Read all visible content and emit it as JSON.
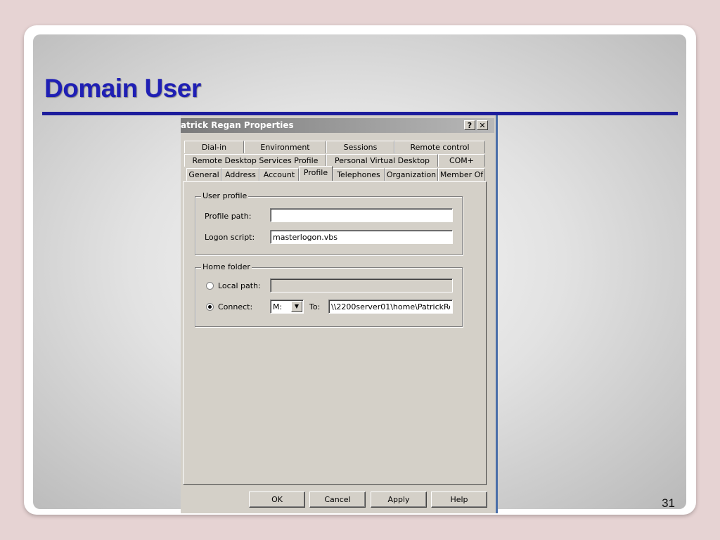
{
  "slide": {
    "title": "Domain User",
    "number": "31"
  },
  "dialog": {
    "title": "atrick Regan Properties",
    "help_glyph": "?",
    "close_glyph": "✕",
    "tab_rows": [
      [
        "Dial-in",
        "Environment",
        "Sessions",
        "Remote control"
      ],
      [
        "Remote Desktop Services Profile",
        "Personal Virtual Desktop",
        "COM+"
      ],
      [
        "General",
        "Address",
        "Account",
        "Profile",
        "Telephones",
        "Organization",
        "Member Of"
      ]
    ],
    "active_tab": "Profile",
    "user_profile": {
      "label": "User profile",
      "profile_path_label": "Profile path:",
      "profile_path_value": "",
      "logon_script_label": "Logon script:",
      "logon_script_value": "masterlogon.vbs"
    },
    "home_folder": {
      "label": "Home folder",
      "local_path_label": "Local path:",
      "local_path_value": "",
      "connect_label": "Connect:",
      "drive": "M:",
      "to_label": "To:",
      "to_value": "\\\\2200server01\\home\\PatrickRe",
      "selected": "connect"
    },
    "buttons": {
      "ok": "OK",
      "cancel": "Cancel",
      "apply": "Apply",
      "help": "Help"
    }
  }
}
